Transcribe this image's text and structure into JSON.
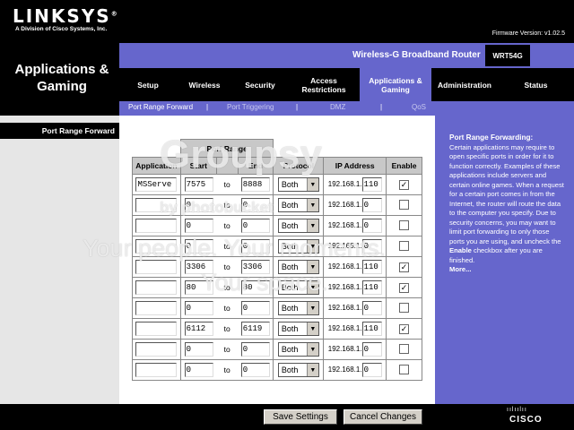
{
  "header": {
    "logo": "LINKSYS",
    "logo_mark": "®",
    "logo_sub": "A Division of Cisco Systems, Inc.",
    "firmware": "Firmware Version: v1.02.5",
    "product_name": "Wireless-G Broadband Router",
    "model": "WRT54G",
    "section_title": "Applications & Gaming"
  },
  "nav": {
    "tabs": [
      {
        "label": "Setup",
        "active": false
      },
      {
        "label": "Wireless",
        "active": false
      },
      {
        "label": "Security",
        "active": false
      },
      {
        "label": "Access Restrictions",
        "active": false
      },
      {
        "label": "Applications & Gaming",
        "active": true
      },
      {
        "label": "Administration",
        "active": false
      },
      {
        "label": "Status",
        "active": false
      }
    ],
    "subtabs": [
      {
        "label": "Port Range Forward",
        "active": true
      },
      {
        "label": "Port Triggering",
        "active": false
      },
      {
        "label": "DMZ",
        "active": false
      },
      {
        "label": "QoS",
        "active": false
      }
    ],
    "separator": "|"
  },
  "left": {
    "label": "Port Range Forward"
  },
  "table": {
    "group_header": "Port Range",
    "headers": {
      "application": "Application",
      "start": "Start",
      "end": "End",
      "protocol": "Protocol",
      "ip": "IP Address",
      "enable": "Enable"
    },
    "to_label": "to",
    "ip_prefix": "192.168.1.",
    "rows": [
      {
        "app": "MSServe",
        "start": "7575",
        "end": "8888",
        "protocol": "Both",
        "ip": "110",
        "enabled": true
      },
      {
        "app": "",
        "start": "0",
        "end": "0",
        "protocol": "Both",
        "ip": "0",
        "enabled": false
      },
      {
        "app": "",
        "start": "0",
        "end": "0",
        "protocol": "Both",
        "ip": "0",
        "enabled": false
      },
      {
        "app": "",
        "start": "0",
        "end": "0",
        "protocol": "Both",
        "ip": "0",
        "enabled": false
      },
      {
        "app": "",
        "start": "3306",
        "end": "3306",
        "protocol": "Both",
        "ip": "110",
        "enabled": true
      },
      {
        "app": "",
        "start": "80",
        "end": "80",
        "protocol": "Both",
        "ip": "110",
        "enabled": true
      },
      {
        "app": "",
        "start": "0",
        "end": "0",
        "protocol": "Both",
        "ip": "0",
        "enabled": false
      },
      {
        "app": "",
        "start": "6112",
        "end": "6119",
        "protocol": "Both",
        "ip": "110",
        "enabled": true
      },
      {
        "app": "",
        "start": "0",
        "end": "0",
        "protocol": "Both",
        "ip": "0",
        "enabled": false
      },
      {
        "app": "",
        "start": "0",
        "end": "0",
        "protocol": "Both",
        "ip": "0",
        "enabled": false
      }
    ]
  },
  "help": {
    "title": "Port Range Forwarding:",
    "body_before_bold": "Certain applications may require to open specific ports in order for it to function correctly. Examples of these applications include servers and certain online games. When a request for a certain port comes in from the Internet, the router will route the data to the computer you specify. Due to security concerns, you may want to limit port forwarding to only those ports you are using, and uncheck the ",
    "bold_word": "Enable",
    "body_after_bold": " checkbox after you are finished.",
    "more": "More..."
  },
  "footer": {
    "save": "Save Settings",
    "cancel": "Cancel Changes",
    "cisco_bars": "ıılıılıı",
    "cisco": "CISCO"
  },
  "watermark": {
    "brand": "Groupsy",
    "by": "by photobucket",
    "line1": "Your people. Your moments.",
    "line2": "Your space."
  },
  "colors": {
    "accent_purple": "#6666cc",
    "black": "#000000",
    "panel_gray": "#e6e6e6"
  }
}
